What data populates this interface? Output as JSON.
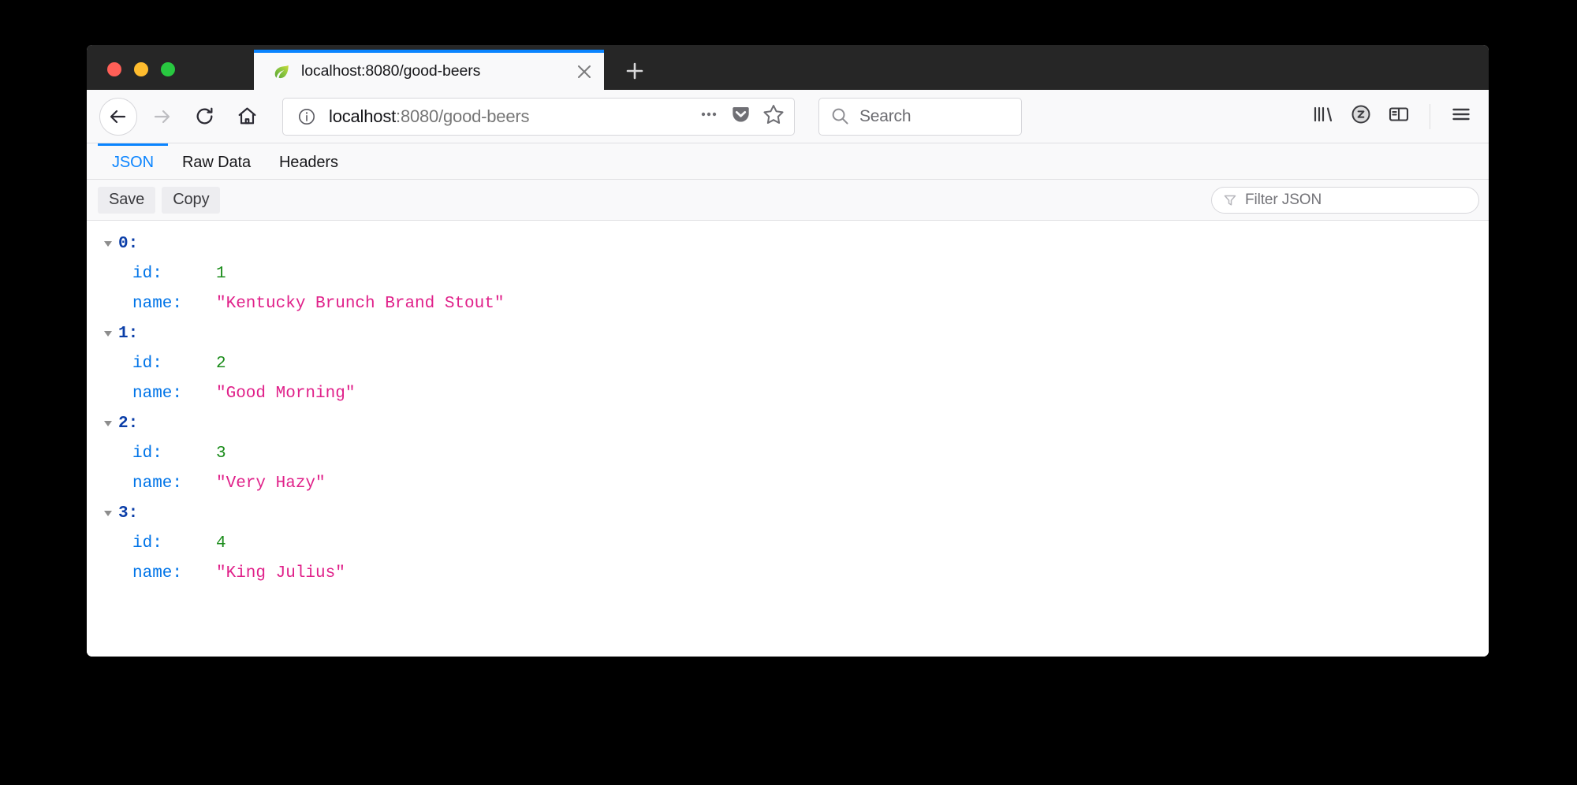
{
  "window": {
    "traffic_lights": [
      {
        "name": "close",
        "color": "#ff5f57"
      },
      {
        "name": "minimize",
        "color": "#febc2e"
      },
      {
        "name": "zoom",
        "color": "#28c840"
      }
    ]
  },
  "tabstrip": {
    "tabs": [
      {
        "title": "localhost:8080/good-beers",
        "favicon": "spring-leaf-icon",
        "active": true,
        "close_label": "✕"
      }
    ],
    "new_tab_label": "+",
    "accent_color": "#0a84ff"
  },
  "navbar": {
    "back_label": "←",
    "forward_label": "→",
    "reload_label": "↻",
    "home_label": "⌂",
    "url": {
      "host": "localhost",
      "path": ":8080/good-beers",
      "full": "localhost:8080/good-beers",
      "identity_icon": "info-icon"
    },
    "page_actions_label": "•••",
    "pocket_icon": "pocket-icon",
    "bookmark_icon": "star-icon",
    "search": {
      "placeholder": "Search",
      "icon": "search-icon"
    },
    "library_icon": "library-icon",
    "account_icon": "account-icon",
    "sidebar_icon": "sidebar-icon",
    "menu_icon": "hamburger-menu-icon"
  },
  "json_viewer": {
    "tabs": [
      {
        "label": "JSON",
        "active": true
      },
      {
        "label": "Raw Data",
        "active": false
      },
      {
        "label": "Headers",
        "active": false
      }
    ],
    "toolbar": {
      "save_label": "Save",
      "copy_label": "Copy",
      "filter_placeholder": "Filter JSON",
      "filter_icon": "funnel-icon"
    },
    "colors": {
      "index": "#0b3ea8",
      "key": "#0074e8",
      "number": "#1a8c1a",
      "string": "#e0218a",
      "accent": "#0a84ff"
    },
    "entries": [
      {
        "index": "0:",
        "props": [
          {
            "key": "id:",
            "value": "1",
            "type": "number"
          },
          {
            "key": "name:",
            "value": "\"Kentucky Brunch Brand Stout\"",
            "type": "string"
          }
        ]
      },
      {
        "index": "1:",
        "props": [
          {
            "key": "id:",
            "value": "2",
            "type": "number"
          },
          {
            "key": "name:",
            "value": "\"Good Morning\"",
            "type": "string"
          }
        ]
      },
      {
        "index": "2:",
        "props": [
          {
            "key": "id:",
            "value": "3",
            "type": "number"
          },
          {
            "key": "name:",
            "value": "\"Very Hazy\"",
            "type": "string"
          }
        ]
      },
      {
        "index": "3:",
        "props": [
          {
            "key": "id:",
            "value": "4",
            "type": "number"
          },
          {
            "key": "name:",
            "value": "\"King Julius\"",
            "type": "string"
          }
        ]
      }
    ]
  }
}
